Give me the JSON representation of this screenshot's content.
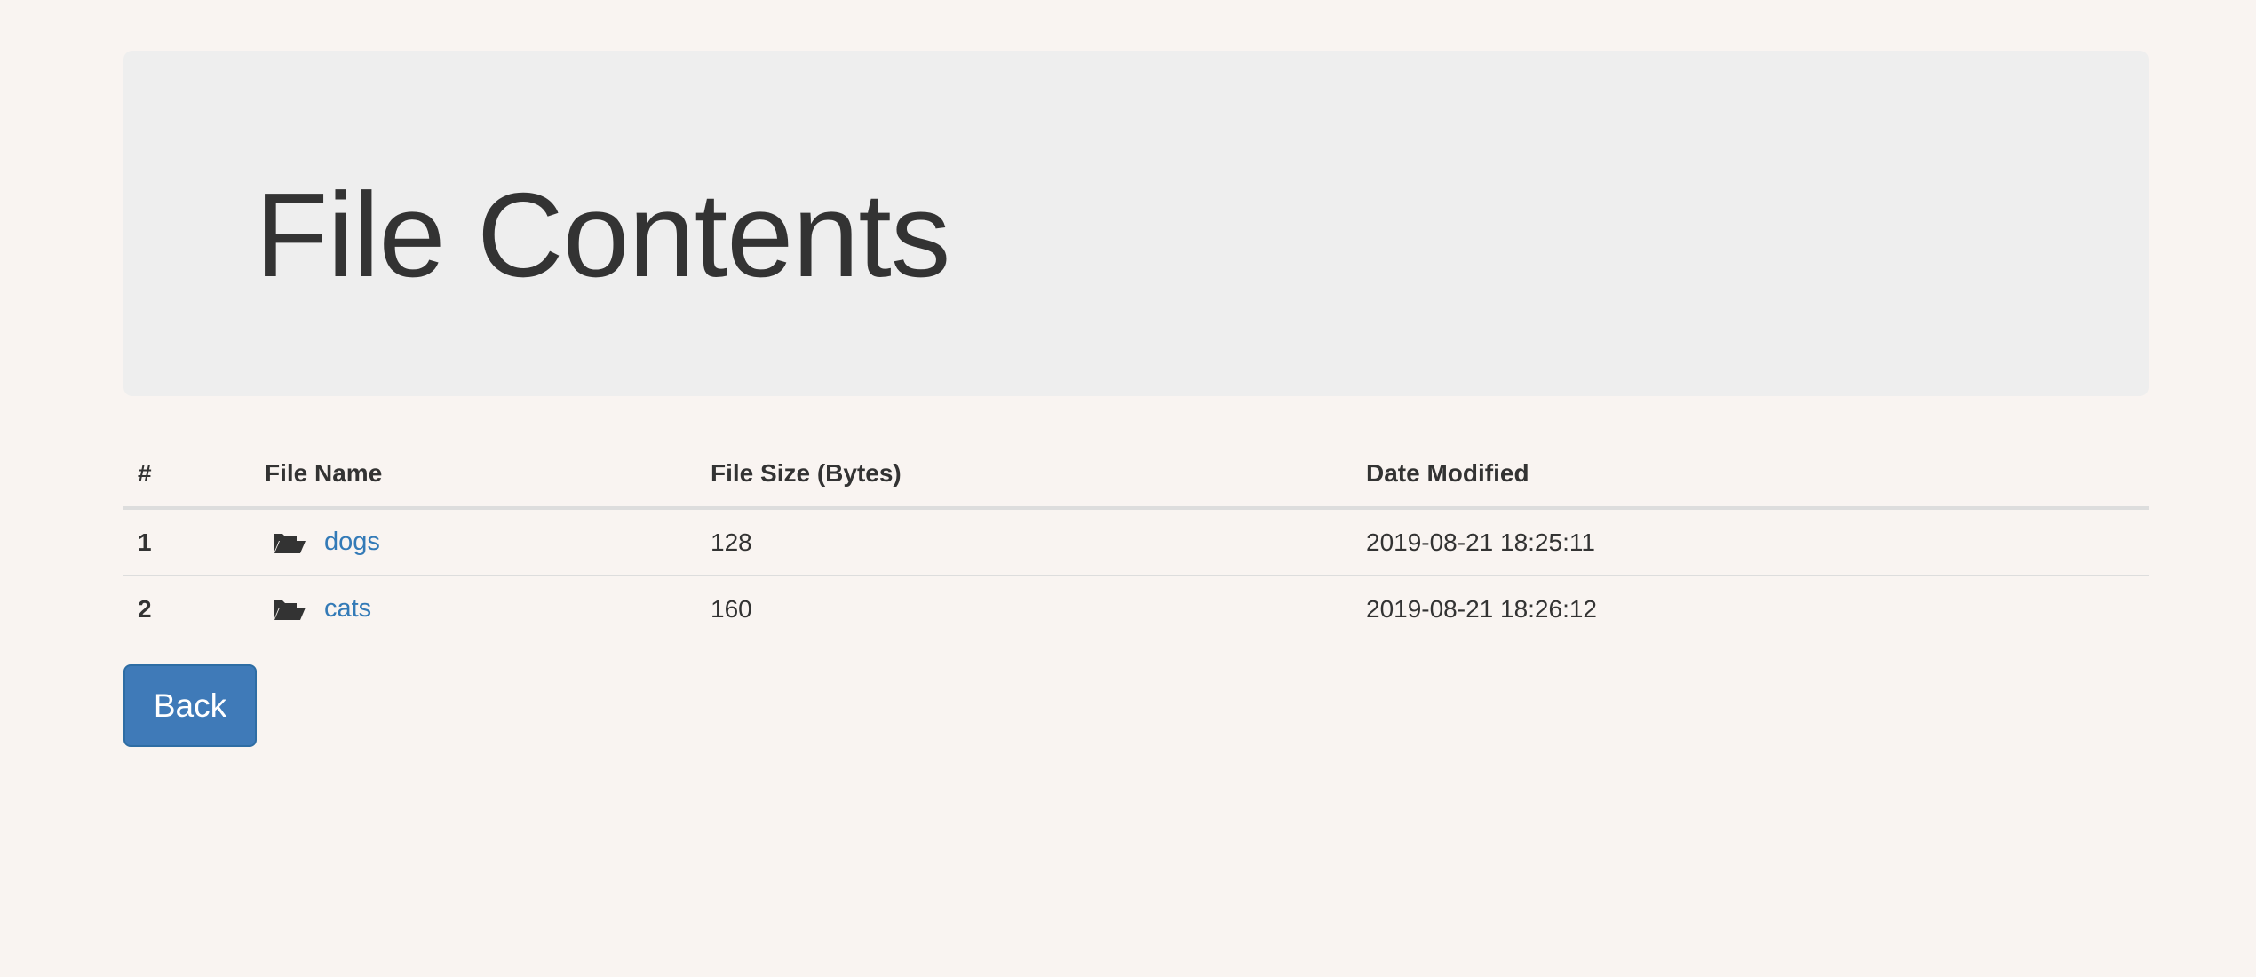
{
  "page": {
    "title": "File Contents"
  },
  "table": {
    "headers": {
      "num": "#",
      "name": "File Name",
      "size": "File Size (Bytes)",
      "modified": "Date Modified"
    },
    "rows": [
      {
        "num": "1",
        "icon": "folder-open-icon",
        "name": "dogs",
        "size": "128",
        "modified": "2019-08-21 18:25:11"
      },
      {
        "num": "2",
        "icon": "folder-open-icon",
        "name": "cats",
        "size": "160",
        "modified": "2019-08-21 18:26:12"
      }
    ]
  },
  "actions": {
    "back_label": "Back"
  },
  "colors": {
    "background": "#f9f4f1",
    "jumbotron": "#eeeeee",
    "link": "#337ab7",
    "primary_button": "#3f7ab8",
    "text": "#333333"
  }
}
